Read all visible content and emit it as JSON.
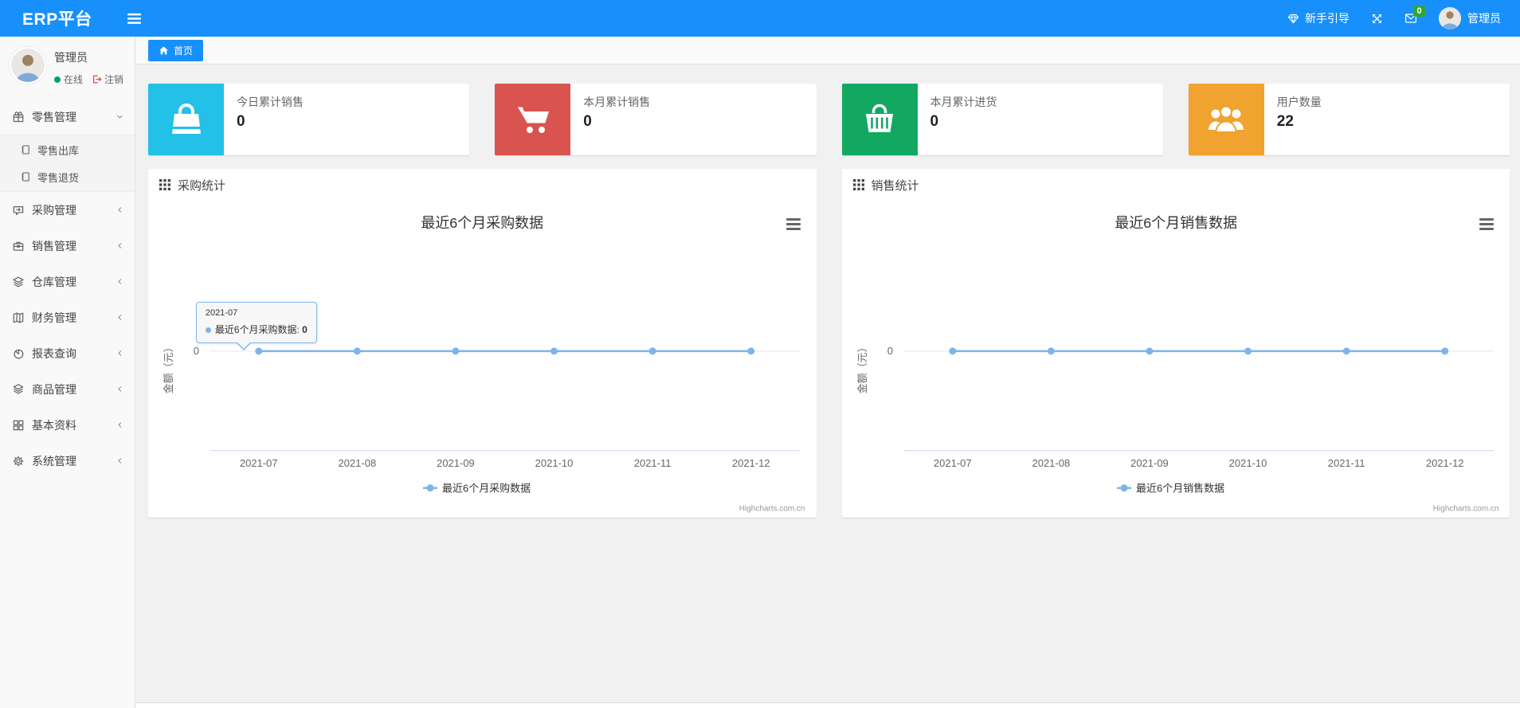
{
  "colors": {
    "navbar_bg": "#1890fb",
    "accent": "#1890fb",
    "badge_green": "#2fa72e",
    "status_green": "#00a65a",
    "logout_red": "#dd4b39",
    "content_bg": "#f1f1f2",
    "sidebar_bg": "#f9f9f9",
    "series_line": "#7cb5ec"
  },
  "navbar": {
    "brand": "ERP平台",
    "menu_icon": "hamburger-icon",
    "guide_label": "新手引导",
    "guide_icon": "diamond-icon",
    "fullscreen_icon": "fullscreen-icon",
    "message_icon": "envelope-icon",
    "message_badge": "0",
    "user_name": "管理员",
    "user_icon": "avatar"
  },
  "sidebar": {
    "user": {
      "name": "管理员",
      "status": "在线",
      "logout": "注销",
      "status_icon": "online-dot",
      "logout_icon": "logout-icon"
    },
    "menu": [
      {
        "key": "retail",
        "label": "零售管理",
        "icon": "gift-icon",
        "state": "expanded",
        "children": [
          {
            "key": "retail-outbound",
            "label": "零售出库",
            "icon": "file-icon"
          },
          {
            "key": "retail-return",
            "label": "零售退货",
            "icon": "file-icon"
          }
        ]
      },
      {
        "key": "purchase",
        "label": "采购管理",
        "icon": "repeat-icon",
        "state": "collapsed"
      },
      {
        "key": "sales",
        "label": "销售管理",
        "icon": "briefcase-icon",
        "state": "collapsed"
      },
      {
        "key": "warehouse",
        "label": "仓库管理",
        "icon": "layers-icon",
        "state": "collapsed"
      },
      {
        "key": "finance",
        "label": "财务管理",
        "icon": "book-icon",
        "state": "collapsed"
      },
      {
        "key": "reports",
        "label": "报表查询",
        "icon": "pie-chart-icon",
        "state": "collapsed"
      },
      {
        "key": "goods",
        "label": "商品管理",
        "icon": "box-icon",
        "state": "collapsed"
      },
      {
        "key": "basic-data",
        "label": "基本资料",
        "icon": "grid-icon",
        "state": "collapsed"
      },
      {
        "key": "system",
        "label": "系统管理",
        "icon": "gear-icon",
        "state": "collapsed"
      }
    ]
  },
  "tabs": [
    {
      "key": "home",
      "label": "首页",
      "icon": "home-icon",
      "active": true
    }
  ],
  "cards": [
    {
      "key": "today-sales",
      "label": "今日累计销售",
      "value": "0",
      "icon": "shopping-bag-icon",
      "color": "#23c0e8"
    },
    {
      "key": "month-sales",
      "label": "本月累计销售",
      "value": "0",
      "icon": "cart-icon",
      "color": "#d9534f"
    },
    {
      "key": "month-purchase",
      "label": "本月累计进货",
      "value": "0",
      "icon": "basket-icon",
      "color": "#12a862"
    },
    {
      "key": "user-count",
      "label": "用户数量",
      "value": "22",
      "icon": "users-icon",
      "color": "#f0a32f"
    }
  ],
  "panels": [
    {
      "key": "purchase-stats",
      "title": "采购统计",
      "icon": "grid9-icon"
    },
    {
      "key": "sales-stats",
      "title": "销售统计",
      "icon": "grid9-icon"
    }
  ],
  "chart_data": [
    {
      "type": "line",
      "title": "最近6个月采购数据",
      "categories": [
        "2021-07",
        "2021-08",
        "2021-09",
        "2021-10",
        "2021-11",
        "2021-12"
      ],
      "series": [
        {
          "name": "最近6个月采购数据",
          "values": [
            0,
            0,
            0,
            0,
            0,
            0
          ]
        }
      ],
      "xlabel": "",
      "ylabel": "金额（元）",
      "yticks": [
        "0"
      ],
      "ylim": [
        -1,
        1
      ],
      "grid": "zero-gridline-only",
      "legend_position": "bottom",
      "line_color": "#7cb5ec",
      "credits": "Highcharts.com.cn",
      "tooltip": {
        "visible": true,
        "header": "2021-07",
        "series": "最近6个月采购数据",
        "value": "0",
        "point_index": 0
      }
    },
    {
      "type": "line",
      "title": "最近6个月销售数据",
      "categories": [
        "2021-07",
        "2021-08",
        "2021-09",
        "2021-10",
        "2021-11",
        "2021-12"
      ],
      "series": [
        {
          "name": "最近6个月销售数据",
          "values": [
            0,
            0,
            0,
            0,
            0,
            0
          ]
        }
      ],
      "xlabel": "",
      "ylabel": "金额（元）",
      "yticks": [
        "0"
      ],
      "ylim": [
        -1,
        1
      ],
      "grid": "zero-gridline-only",
      "legend_position": "bottom",
      "line_color": "#7cb5ec",
      "credits": "Highcharts.com.cn",
      "tooltip": {
        "visible": false
      }
    }
  ]
}
